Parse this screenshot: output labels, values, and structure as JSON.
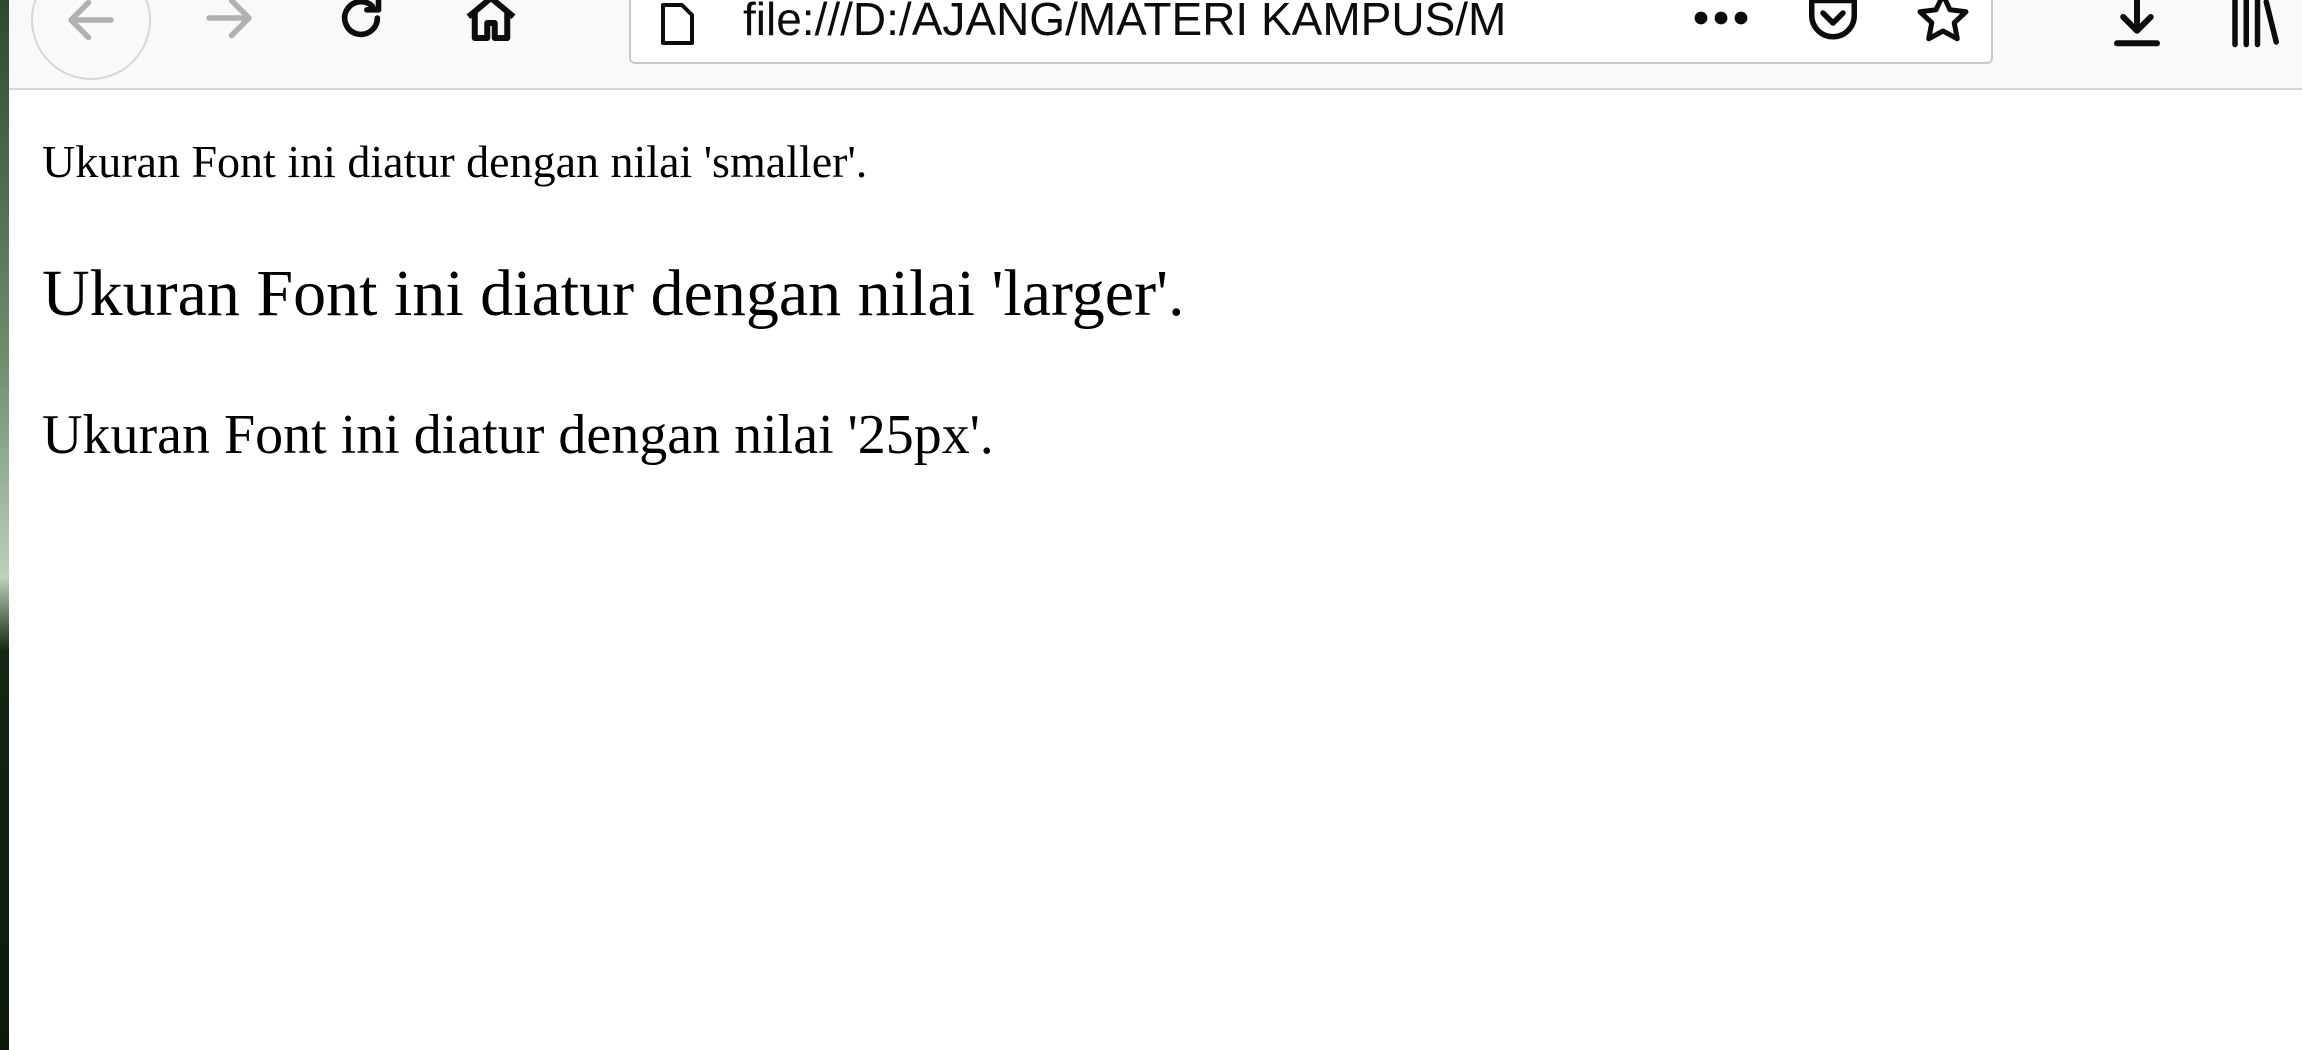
{
  "browser": {
    "address_bar": {
      "url": "file:///D:/AJANG/MATERI KAMPUS/M"
    },
    "icons": {
      "back": "arrow-left-icon",
      "forward": "arrow-right-icon",
      "reload": "reload-icon",
      "home": "home-icon",
      "page": "page-icon",
      "more": "more-dots-icon",
      "pocket": "pocket-icon",
      "bookmark": "star-icon",
      "downloads": "download-icon",
      "library": "library-icon"
    }
  },
  "page": {
    "paragraphs": {
      "smaller": "Ukuran Font ini diatur dengan nilai 'smaller'.",
      "larger": "Ukuran Font ini diatur dengan nilai 'larger'.",
      "px25": "Ukuran Font ini diatur dengan nilai '25px'."
    }
  },
  "colors": {
    "toolbar_bg": "#f9f9fa",
    "icon": "#0c0c0d",
    "icon_disabled": "#b1b1b3",
    "text": "#000000"
  }
}
